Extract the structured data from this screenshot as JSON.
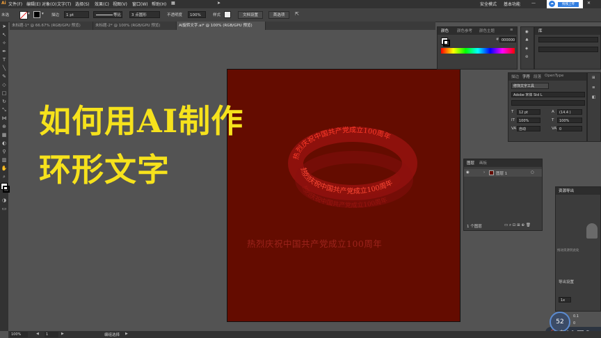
{
  "menubar": {
    "logo": "Ai",
    "items": [
      "文件(F)",
      "编辑(E)",
      "对象(O)",
      "文字(T)",
      "选择(S)",
      "效果(C)",
      "视图(V)",
      "窗口(W)",
      "帮助(H)"
    ],
    "mode_label": "安全模式",
    "workspace": "基本功能",
    "upload_label": "拖拽上传"
  },
  "options_bar": {
    "label_stroke": "描边",
    "stroke_weight": "1 pt",
    "stroke_style": "等比",
    "points": "3 点圆形",
    "opacity_label": "不透明度",
    "opacity_value": "100%",
    "style_label": "样式",
    "doc_settings": "文档设置",
    "preferences": "首选项"
  },
  "tabs": [
    {
      "label": "未标题-1* @ 66.67% (RGB/GPU 预览)",
      "active": false
    },
    {
      "label": "未标题-2* @ 100% (RGB/GPU 预览)",
      "active": false
    },
    {
      "label": "AI旋转文字.ai* @ 100% (RGB/GPU 预览)",
      "active": true
    }
  ],
  "overlay": {
    "line1": "如何用AI制作",
    "line2": "环形文字",
    "color": "#f6e21c"
  },
  "artwork": {
    "ring_text": "热烈庆祝中国共产党成立100周年",
    "bottom_text": "热烈庆祝中国共产党成立100周年",
    "bg_color": "#640c00"
  },
  "color_panel": {
    "tabs": [
      "颜色",
      "颜色参考",
      "颜色主题"
    ],
    "hex": "000000"
  },
  "library_panel": {
    "tab": "库"
  },
  "character_panel": {
    "tabs": [
      "描边",
      "字符",
      "段落",
      "OpenType"
    ],
    "touch_tool": "修饰文字工具",
    "font": "Adobe 宋体 Std L",
    "size": "12 pt",
    "leading": "(14.4 )",
    "vscale": "100%",
    "hscale": "100%",
    "kerning": "自动",
    "tracking": "0",
    "shift": "0",
    "rotate": "0"
  },
  "layers_panel": {
    "tabs": [
      "图层",
      "画板"
    ],
    "layer_name": "图层 1",
    "footer": "1 个图层"
  },
  "export_panel": {
    "title": "资源导出",
    "hint": "拖动资源到此处",
    "settings": "导出设置",
    "scale": "1x"
  },
  "speed_widget": {
    "percent": "52",
    "up": "0.1",
    "down": "0"
  },
  "status": {
    "zoom": "100%",
    "page": "1",
    "tool": "编组选择"
  }
}
